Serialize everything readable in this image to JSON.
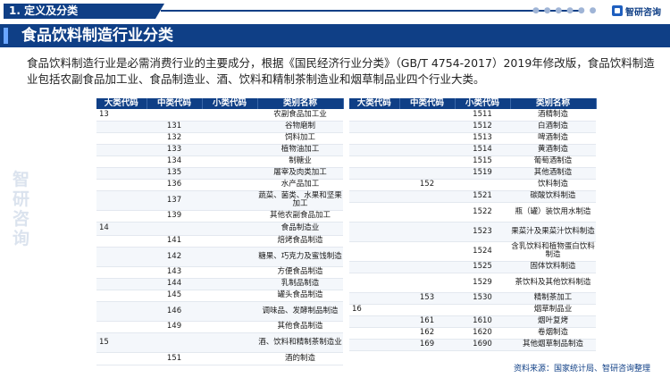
{
  "header": {
    "section_title": "1. 定义及分类",
    "dots": "● ● ● ● ● ●",
    "logo_text": "智研咨询"
  },
  "banner": {
    "title": "食品饮料制造行业分类"
  },
  "intro": {
    "text": "食品饮料制造行业是必需消费行业的主要成分，根据《国民经济行业分类》（GB/T 4754-2017）2019年修改版，食品饮料制造业包括农副食品加工业、食品制造业、酒、饮料和精制茶制造业和烟草制品业四个行业大类。"
  },
  "watermark": "智研咨询",
  "columns": [
    "大类代码",
    "中类代码",
    "小类代码",
    "类别名称"
  ],
  "left_rows": [
    {
      "h": 13,
      "c": [
        "13",
        "",
        "",
        "农副食品加工业"
      ]
    },
    {
      "h": 13,
      "c": [
        "",
        "131",
        "",
        "谷物磨制"
      ]
    },
    {
      "h": 13,
      "c": [
        "",
        "132",
        "",
        "饲料加工"
      ]
    },
    {
      "h": 13,
      "c": [
        "",
        "133",
        "",
        "植物油加工"
      ]
    },
    {
      "h": 13,
      "c": [
        "",
        "134",
        "",
        "制糖业"
      ]
    },
    {
      "h": 13,
      "c": [
        "",
        "135",
        "",
        "屠宰及肉类加工"
      ]
    },
    {
      "h": 13,
      "c": [
        "",
        "136",
        "",
        "水产品加工"
      ]
    },
    {
      "h": 22,
      "c": [
        "",
        "137",
        "",
        "蔬菜、菌类、水果和坚果加工"
      ]
    },
    {
      "h": 13,
      "c": [
        "",
        "139",
        "",
        "其他农副食品加工"
      ]
    },
    {
      "h": 15,
      "c": [
        "14",
        "",
        "",
        "食品制造业"
      ]
    },
    {
      "h": 13,
      "c": [
        "",
        "141",
        "",
        "焙烤食品制造"
      ]
    },
    {
      "h": 22,
      "c": [
        "",
        "142",
        "",
        "糖果、巧克力及蜜饯制造"
      ]
    },
    {
      "h": 13,
      "c": [
        "",
        "143",
        "",
        "方便食品制造"
      ]
    },
    {
      "h": 13,
      "c": [
        "",
        "144",
        "",
        "乳制品制造"
      ]
    },
    {
      "h": 13,
      "c": [
        "",
        "145",
        "",
        "罐头食品制造"
      ]
    },
    {
      "h": 22,
      "c": [
        "",
        "146",
        "",
        "调味品、发酵制品制造"
      ]
    },
    {
      "h": 13,
      "c": [
        "",
        "149",
        "",
        "其他食品制造"
      ]
    },
    {
      "h": 22,
      "c": [
        "15",
        "",
        "",
        "酒、饮料和精制茶制造业"
      ]
    },
    {
      "h": 14,
      "c": [
        "",
        "151",
        "",
        "酒的制造"
      ]
    }
  ],
  "right_rows": [
    {
      "h": 13,
      "c": [
        "",
        "",
        "1511",
        "酒精制造"
      ]
    },
    {
      "h": 13,
      "c": [
        "",
        "",
        "1512",
        "白酒制造"
      ]
    },
    {
      "h": 13,
      "c": [
        "",
        "",
        "1513",
        "啤酒制造"
      ]
    },
    {
      "h": 13,
      "c": [
        "",
        "",
        "1514",
        "黄酒制造"
      ]
    },
    {
      "h": 13,
      "c": [
        "",
        "",
        "1515",
        "葡萄酒制造"
      ]
    },
    {
      "h": 13,
      "c": [
        "",
        "",
        "1519",
        "其他酒制造"
      ]
    },
    {
      "h": 13,
      "c": [
        "",
        "152",
        "",
        "饮料制造"
      ]
    },
    {
      "h": 13,
      "c": [
        "",
        "",
        "1521",
        "碳酸饮料制造"
      ]
    },
    {
      "h": 22,
      "c": [
        "",
        "",
        "1522",
        "瓶（罐）装饮用水制造"
      ]
    },
    {
      "h": 22,
      "c": [
        "",
        "",
        "1523",
        "果菜汁及果菜汁饮料制造"
      ]
    },
    {
      "h": 22,
      "c": [
        "",
        "",
        "1524",
        "含乳饮料和植物蛋白饮料制造"
      ]
    },
    {
      "h": 13,
      "c": [
        "",
        "",
        "1525",
        "固体饮料制造"
      ]
    },
    {
      "h": 22,
      "c": [
        "",
        "",
        "1529",
        "茶饮料及其他饮料制造"
      ]
    },
    {
      "h": 13,
      "c": [
        "",
        "153",
        "1530",
        "精制茶加工"
      ]
    },
    {
      "h": 13,
      "c": [
        "16",
        "",
        "",
        "烟草制品业"
      ]
    },
    {
      "h": 13,
      "c": [
        "",
        "161",
        "1610",
        "烟叶复烤"
      ]
    },
    {
      "h": 13,
      "c": [
        "",
        "162",
        "1620",
        "卷烟制造"
      ]
    },
    {
      "h": 13,
      "c": [
        "",
        "169",
        "1690",
        "其他烟草制品制造"
      ]
    }
  ],
  "source": "资料来源：国家统计局、智研咨询整理"
}
